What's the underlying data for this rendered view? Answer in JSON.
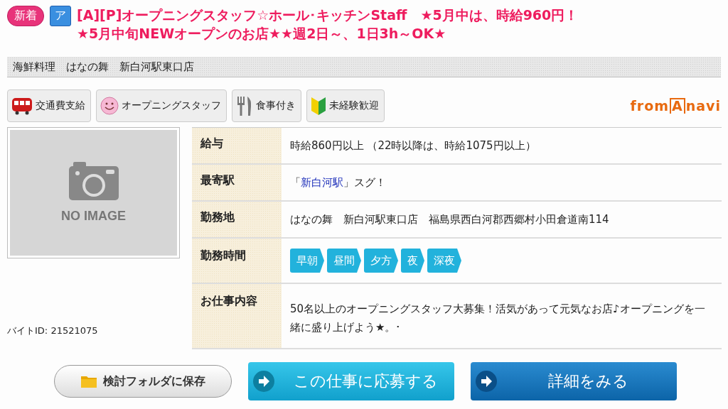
{
  "header": {
    "badges": [
      {
        "kind": "new",
        "label": "新着"
      },
      {
        "kind": "type",
        "label": "ア"
      }
    ],
    "title_lines": [
      "[A][P]オープニングスタッフ☆ホール･キッチンStaff　★5月中は、時給960円！",
      "★5月中旬NEWオープンのお店★★週2日～、1日3h～OK★"
    ]
  },
  "shop_name": "海鮮料理　はなの舞　新白河駅東口店",
  "tags": [
    {
      "kind": "train",
      "label": "交通費支給"
    },
    {
      "kind": "smile",
      "label": "オープニングスタッフ"
    },
    {
      "kind": "meal",
      "label": "食事付き"
    },
    {
      "kind": "beginner",
      "label": "未経験歓迎"
    }
  ],
  "logo": {
    "part1": "from",
    "part2": "A",
    "part3": "navi"
  },
  "photo": {
    "kind": "no_image",
    "label": "NO IMAGE"
  },
  "job_id": {
    "label": "バイトID:",
    "value": "21521075"
  },
  "details": [
    {
      "kind": "text",
      "label": "給与",
      "value": "時給860円以上 （22時以降は、時給1075円以上）"
    },
    {
      "kind": "station",
      "label": "最寄駅",
      "before": "「",
      "link": "新白河駅",
      "after": "」スグ！"
    },
    {
      "kind": "text",
      "label": "勤務地",
      "value": "はなの舞　新白河駅東口店　福島県西白河郡西郷村小田倉道南114"
    },
    {
      "kind": "shifts",
      "label": "勤務時間",
      "shifts": [
        "早朝",
        "昼間",
        "夕方",
        "夜",
        "深夜"
      ]
    },
    {
      "kind": "text",
      "label": "お仕事内容",
      "value": "50名以上のオープニングスタッフ大募集！活気があって元気なお店♪オープニングを一緒に盛り上げよう★。･"
    }
  ],
  "buttons": [
    {
      "kind": "save",
      "label": "検討フォルダに保存"
    },
    {
      "kind": "apply",
      "label": "この仕事に応募する"
    },
    {
      "kind": "detail",
      "label": "詳細をみる"
    }
  ]
}
